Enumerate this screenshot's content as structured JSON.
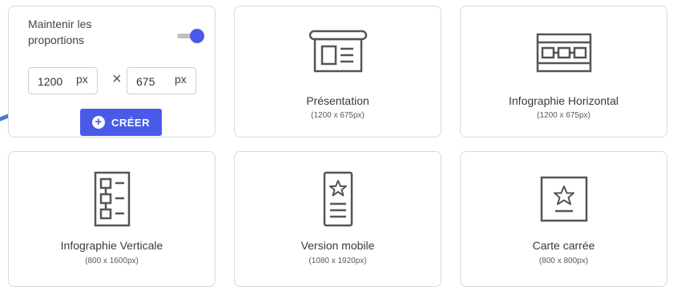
{
  "custom": {
    "keep_ratio_label": "Maintenir les proportions",
    "keep_ratio_on": true,
    "width_value": "1200",
    "height_value": "675",
    "unit": "px",
    "times_symbol": "×",
    "create_label": "CRÉER",
    "accent_color": "#4a5ae8"
  },
  "templates": [
    {
      "icon": "presentation-icon",
      "title": "Présentation",
      "size": "(1200 x 675px)"
    },
    {
      "icon": "horizontal-infographic-icon",
      "title": "Infographie Horizontal",
      "size": "(1200 x 675px)"
    },
    {
      "icon": "vertical-infographic-icon",
      "title": "Infographie Verticale",
      "size": "(800 x 1600px)"
    },
    {
      "icon": "mobile-version-icon",
      "title": "Version mobile",
      "size": "(1080 x 1920px)"
    },
    {
      "icon": "square-card-icon",
      "title": "Carte carrée",
      "size": "(800 x 800px)"
    }
  ]
}
